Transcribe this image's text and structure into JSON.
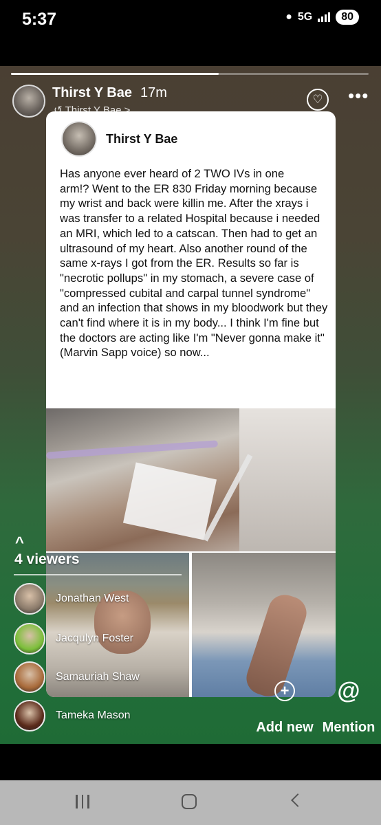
{
  "status_bar": {
    "time": "5:37",
    "network": "5G",
    "battery": "80"
  },
  "story": {
    "progress_fraction": 0.58,
    "author": "Thirst Y Bae",
    "age": "17m",
    "shared_from": "Thirst Y Bae",
    "shared_chevron": ">",
    "reaction_icon": "heart-reaction-icon",
    "more_label": "•••"
  },
  "post": {
    "author": "Thirst Y Bae",
    "text": "Has anyone ever heard of 2 TWO IVs in one arm!? Went to the ER 830 Friday morning because my wrist and back were killin me. After the xrays i was transfer to a related Hospital because i needed an MRI, which led to a catscan. Then had to get an ultrasound of my heart. Also another round of the same x-rays I got from the ER. Results so far is \"necrotic pollups\" in my stomach, a severe case of \"compressed cubital and carpal tunnel syndrome\" and an infection that shows in my bloodwork but they can't find where it is in my body... I think I'm fine but the doctors are acting like I'm \"Never gonna make it\" (Marvin Sapp voice) so now..."
  },
  "viewers": {
    "chevron": "^",
    "count_label": "4 viewers",
    "list": [
      {
        "name": "Jonathan West",
        "avatar_color": "#8a7a6a"
      },
      {
        "name": "Jacqulyn Foster",
        "avatar_color": "#7cbf3a"
      },
      {
        "name": "Samauriah Shaw",
        "avatar_color": "#a86a3a"
      },
      {
        "name": "Tameka Mason",
        "avatar_color": "#5a2a1a"
      }
    ]
  },
  "actions": {
    "add_new_label": "Add new",
    "add_new_icon": "+",
    "mention_label": "Mention",
    "mention_icon": "@"
  }
}
